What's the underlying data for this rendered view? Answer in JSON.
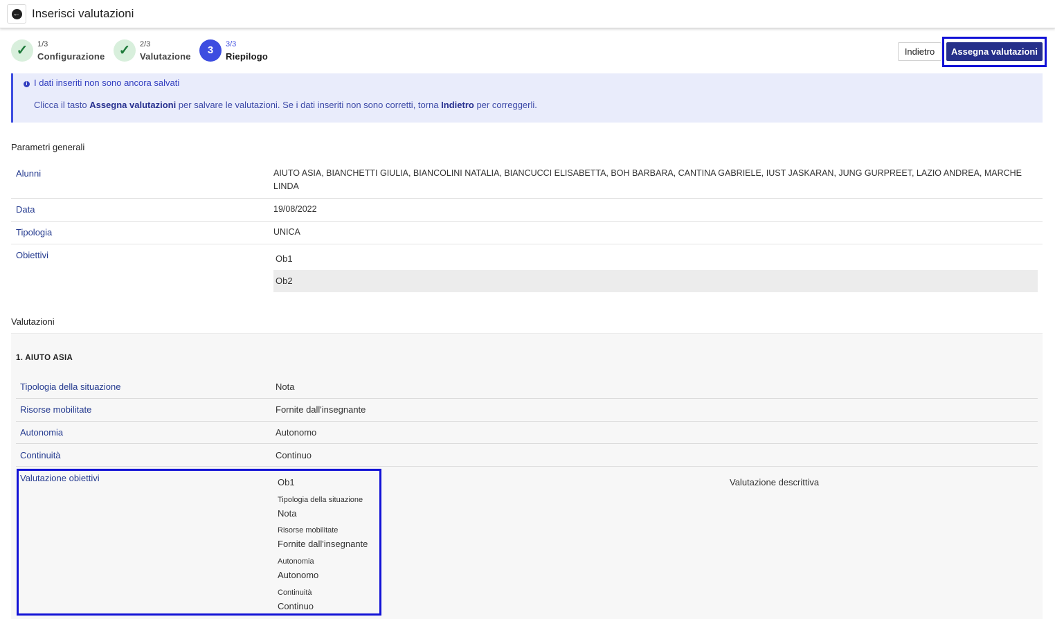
{
  "header": {
    "title": "Inserisci valutazioni",
    "back_icon": "arrow-left-icon"
  },
  "stepper": [
    {
      "num": "1/3",
      "label": "Configurazione",
      "state": "done"
    },
    {
      "num": "2/3",
      "label": "Valutazione",
      "state": "done"
    },
    {
      "num": "3/3",
      "label": "Riepilogo",
      "state": "current",
      "badge": "3"
    }
  ],
  "actions": {
    "back_label": "Indietro",
    "assign_label": "Assegna valutazioni"
  },
  "info": {
    "title": "I dati inseriti non sono ancora salvati",
    "text_1": "Clicca il tasto ",
    "bold_1": "Assegna valutazioni",
    "text_2": " per salvare le valutazioni. Se i dati inseriti non sono corretti, torna ",
    "bold_2": "Indietro",
    "text_3": " per correggerli."
  },
  "general": {
    "heading": "Parametri generali",
    "alunni_label": "Alunni",
    "alunni_value_1": "AIUTO ASIA, BIANCHETTI GIULIA, BIANCOLINI NATALIA, BIANCUCCI ELISABETTA, BOH BARBARA, CANTINA GABRIELE, IUST JASKARAN, JUNG GURPREET, LAZIO ANDREA, MARCHE",
    "alunni_value_2": "LINDA",
    "data_label": "Data",
    "data_value": "19/08/2022",
    "tipologia_label": "Tipologia",
    "tipologia_value": "UNICA",
    "obiettivi_label": "Obiettivi",
    "obiettivi": [
      "Ob1",
      "Ob2"
    ]
  },
  "valutazioni": {
    "heading": "Valutazioni",
    "student": "1. AIUTO ASIA",
    "rows": [
      {
        "label": "Tipologia della situazione",
        "value": "Nota"
      },
      {
        "label": "Risorse mobilitate",
        "value": "Fornite dall'insegnante"
      },
      {
        "label": "Autonomia",
        "value": "Autonomo"
      },
      {
        "label": "Continuità",
        "value": "Continuo"
      }
    ],
    "obiettivi_label": "Valutazione obiettivi",
    "objective_name": "Ob1",
    "objective_details": [
      {
        "label": "Tipologia della situazione",
        "value": "Nota"
      },
      {
        "label": "Risorse mobilitate",
        "value": "Fornite dall'insegnante"
      },
      {
        "label": "Autonomia",
        "value": "Autonomo"
      },
      {
        "label": "Continuità",
        "value": "Continuo"
      }
    ],
    "descrittiva_label": "Valutazione descrittiva"
  },
  "colors": {
    "primary": "#252f8a",
    "accent": "#3d4de0",
    "annotation": "#1212d6",
    "success_bg": "#d8efdc"
  }
}
